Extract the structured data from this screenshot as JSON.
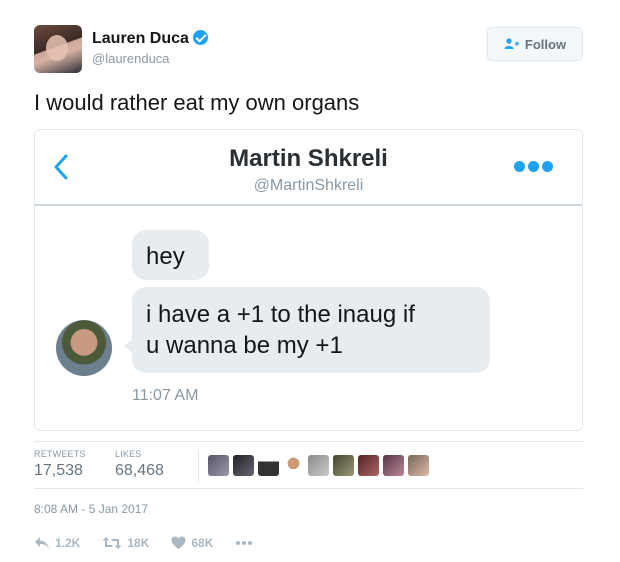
{
  "tweet": {
    "author_name": "Lauren Duca",
    "author_handle": "@laurenduca",
    "verified": true,
    "follow_label": "Follow",
    "text": "I would rather eat my own organs"
  },
  "dm": {
    "contact_name": "Martin Shkreli",
    "contact_handle": "@MartinShkreli",
    "messages": [
      {
        "text": "hey"
      },
      {
        "text_line1": "i have a +1 to the inaug if",
        "text_line2": "u wanna be my +1"
      }
    ],
    "time": "11:07 AM"
  },
  "stats": {
    "retweets_label": "RETWEETS",
    "retweets_value": "17,538",
    "likes_label": "LIKES",
    "likes_value": "68,468",
    "liker_avatar_count": 9
  },
  "timestamp": "8:08 AM - 5 Jan 2017",
  "actions": {
    "reply_count": "1.2K",
    "retweet_count": "18K",
    "like_count": "68K"
  },
  "colors": {
    "accent": "#1da1f2",
    "bubble": "#e6ecf0",
    "muted": "#8899a6",
    "action": "#aab8c2"
  },
  "icons": [
    "verified-badge-icon",
    "follow-person-icon",
    "chevron-left-icon",
    "more-dots-icon",
    "reply-icon",
    "retweet-icon",
    "heart-icon",
    "more-icon"
  ]
}
